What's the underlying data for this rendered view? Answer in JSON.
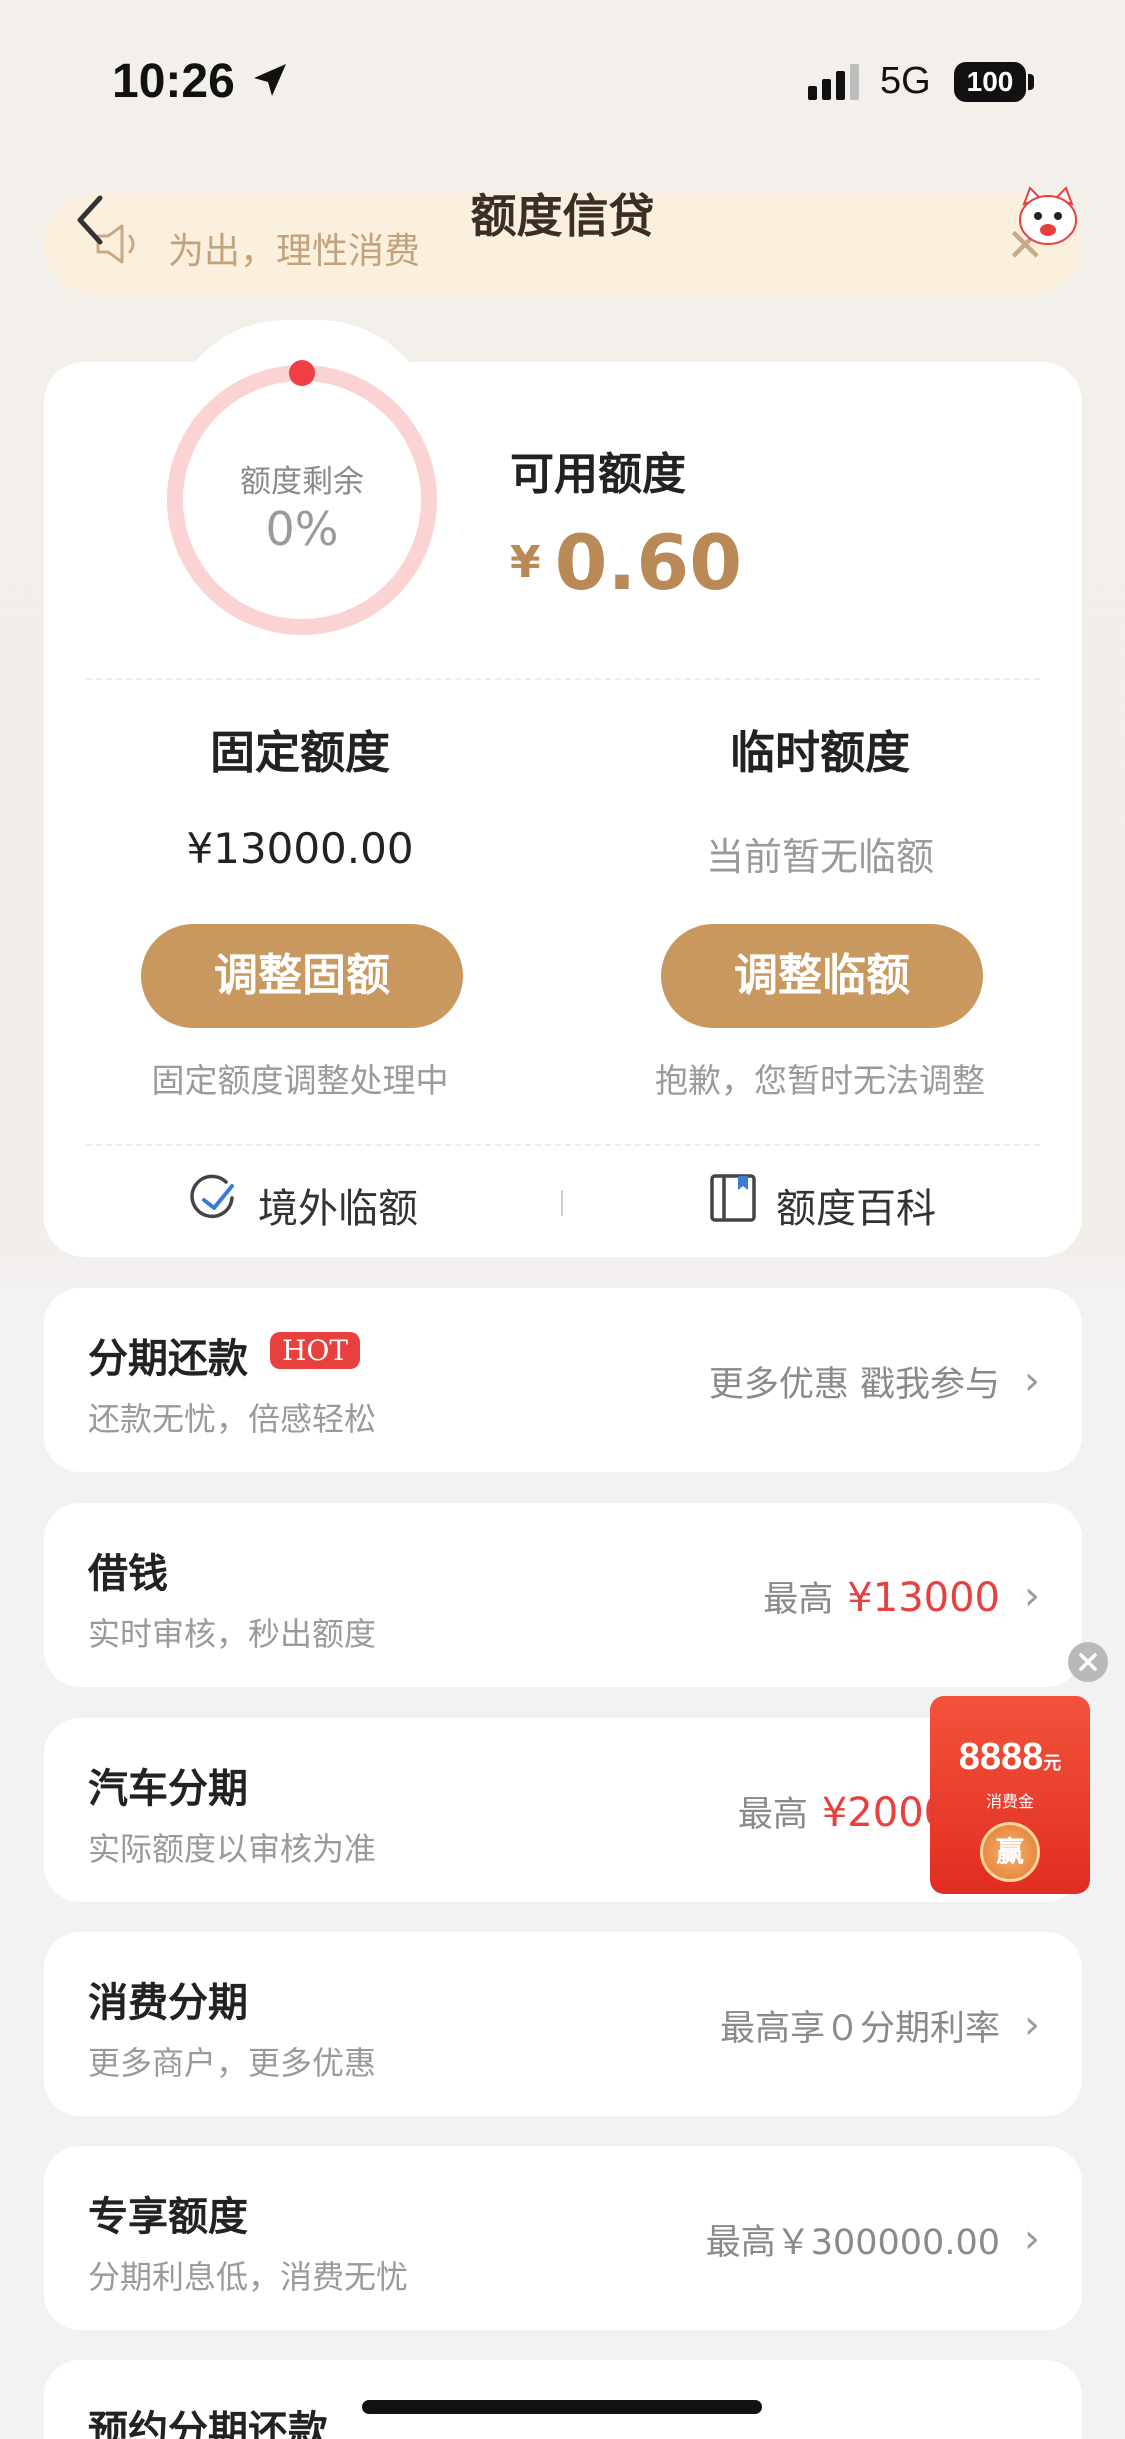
{
  "status_bar": {
    "time": "10:26",
    "network": "5G",
    "battery": "100"
  },
  "header": {
    "title": "额度信贷"
  },
  "notice": {
    "text": "为出，理性消费"
  },
  "credit": {
    "ring_label": "额度剩余",
    "ring_percent": "0%",
    "remaining_fraction": 0,
    "available_label": "可用额度",
    "currency": "¥",
    "available_amount": "0.60",
    "fixed": {
      "title": "固定额度",
      "value": "¥13000.00",
      "button": "调整固额",
      "note": "固定额度调整处理中"
    },
    "temporary": {
      "title": "临时额度",
      "value": "当前暂无临额",
      "button": "调整临额",
      "note": "抱歉，您暂时无法调整"
    },
    "links": [
      {
        "label": "境外临额",
        "icon": "plane-globe-icon"
      },
      {
        "label": "额度百科",
        "icon": "book-icon"
      }
    ]
  },
  "rows": [
    {
      "title": "分期还款",
      "badge": "HOT",
      "subtitle": "还款无忧，倍感轻松",
      "right_text": "更多优惠 戳我参与",
      "right_highlight": ""
    },
    {
      "title": "借钱",
      "subtitle": "实时审核，秒出额度",
      "right_text": "最高",
      "right_highlight": "¥13000"
    },
    {
      "title": "汽车分期",
      "subtitle": "实际额度以审核为准",
      "right_text": "最高",
      "right_highlight": "¥200000"
    },
    {
      "title": "消费分期",
      "subtitle": "更多商户，更多优惠",
      "right_text": "最高享０分期利率",
      "right_highlight": ""
    },
    {
      "title": "专享额度",
      "subtitle": "分期利息低，消费无忧",
      "right_text": "最高￥300000.00",
      "right_highlight": ""
    },
    {
      "title": "预约分期还款",
      "subtitle": "",
      "right_text": "",
      "right_highlight": ""
    }
  ],
  "floating_promo": {
    "amount": "8888",
    "unit": "元",
    "label": "消费金",
    "coin": "赢"
  },
  "colors": {
    "accent": "#c9985f",
    "amount": "#b98a57",
    "red": "#e8403e",
    "ring": "#fbd3d3"
  }
}
